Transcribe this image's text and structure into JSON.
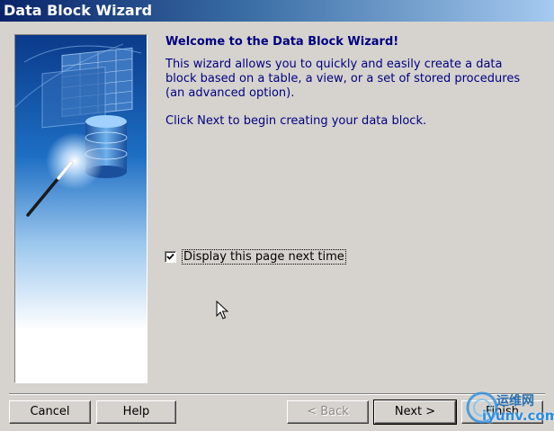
{
  "window": {
    "title": "Data Block Wizard"
  },
  "content": {
    "heading": "Welcome to the Data Block Wizard!",
    "description": "This wizard allows you to quickly and easily create a data block based on a table, a view, or a set of stored procedures (an advanced option).",
    "next_hint": "Click Next to begin creating your data block."
  },
  "options": {
    "display_page_label": "Display this page next time",
    "display_page_checked": true
  },
  "buttons": {
    "cancel": "Cancel",
    "help": "Help",
    "back": "< Back",
    "next": "Next >",
    "finish": "Finish"
  },
  "watermark": {
    "text_cn": "运维网",
    "text_en": "iyunv.com"
  },
  "colors": {
    "title_start": "#0a246a",
    "title_end": "#a6caf0",
    "text_accent": "#000080",
    "face": "#d6d3ce"
  },
  "icons": {
    "wizard_graphic": "database-wand-illustration",
    "checkmark": "check-icon",
    "cursor": "arrow-cursor-icon"
  }
}
